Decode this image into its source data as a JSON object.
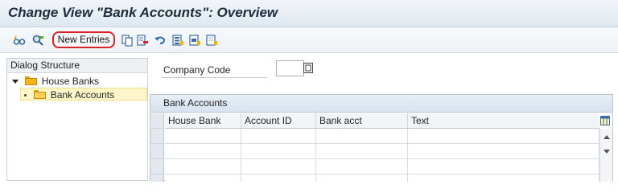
{
  "window": {
    "title": "Change View \"Bank Accounts\": Overview"
  },
  "toolbar": {
    "icons": [
      {
        "name": "display-change-icon",
        "glyph": "glasses"
      },
      {
        "name": "other-view-icon",
        "glyph": "magnifier"
      },
      {
        "name": "copy-as-icon",
        "glyph": "copy"
      },
      {
        "name": "delete-icon",
        "glyph": "delete"
      },
      {
        "name": "undo-change-icon",
        "glyph": "undo"
      },
      {
        "name": "select-all-icon",
        "glyph": "select-all"
      },
      {
        "name": "select-block-icon",
        "glyph": "select-block"
      },
      {
        "name": "deselect-all-icon",
        "glyph": "deselect"
      }
    ],
    "new_entries_label": "New Entries",
    "highlight_color": "#d8232a"
  },
  "dialog_structure": {
    "header": "Dialog Structure",
    "items": [
      {
        "label": "House Banks",
        "level": 0,
        "expanded": true,
        "selected": false
      },
      {
        "label": "Bank Accounts",
        "level": 1,
        "expanded": false,
        "selected": true
      }
    ]
  },
  "company_code": {
    "label": "Company Code",
    "value": ""
  },
  "table": {
    "caption": "Bank Accounts",
    "columns": [
      "House Bank",
      "Account ID",
      "Bank acct",
      "Text"
    ],
    "rows": [
      [
        "",
        "",
        "",
        ""
      ],
      [
        "",
        "",
        "",
        ""
      ],
      [
        "",
        "",
        "",
        ""
      ],
      [
        "",
        "",
        "",
        ""
      ]
    ]
  }
}
